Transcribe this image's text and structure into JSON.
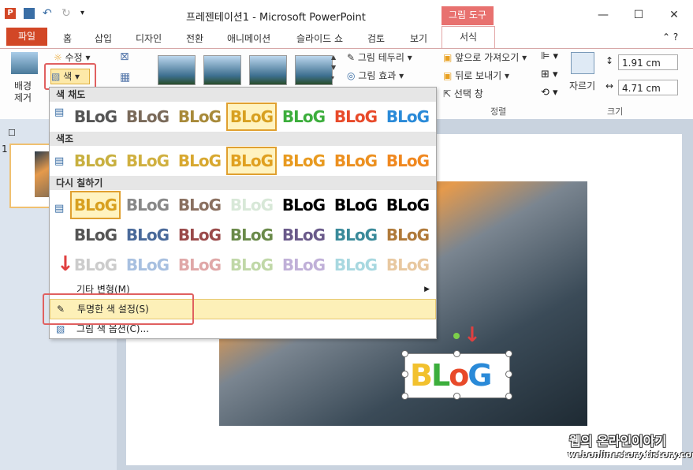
{
  "window": {
    "title": "프레젠테이션1 - Microsoft PowerPoint",
    "context_tab_group": "그림 도구"
  },
  "tabs": [
    "파일",
    "홈",
    "삽입",
    "디자인",
    "전환",
    "애니메이션",
    "슬라이드 쇼",
    "검토",
    "보기",
    "서식"
  ],
  "ribbon": {
    "remove_bg": "배경\n제거",
    "remove_bg_line1": "배경",
    "remove_bg_line2": "제거",
    "corrections": "수정",
    "color": "색",
    "picture_border": "그림 테두리",
    "picture_effects": "그림 효과",
    "bring_forward": "앞으로 가져오기",
    "send_backward": "뒤로 보내기",
    "selection_pane": "선택 창",
    "arrange_group": "정렬",
    "crop": "자르기",
    "height_value": "1.91 cm",
    "width_value": "4.71 cm",
    "size_group": "크기"
  },
  "dropdown": {
    "saturation_header": "색 채도",
    "tone_header": "색조",
    "recolor_header": "다시 칠하기",
    "more_variations": "기타 변형(M)",
    "set_transparent": "투명한 색 설정(S)",
    "picture_color_options": "그림 색 옵션(C)...",
    "swatch_text": "BLoG"
  },
  "slide_panel": {
    "slide_number": "1"
  },
  "watermark": {
    "main": "웹의 온라인이야기",
    "sub": "webonlinestory.tistory.com"
  },
  "colors": {
    "file_tab": "#d24726",
    "context_tab": "#e8716f",
    "highlight_red": "#e06060"
  }
}
